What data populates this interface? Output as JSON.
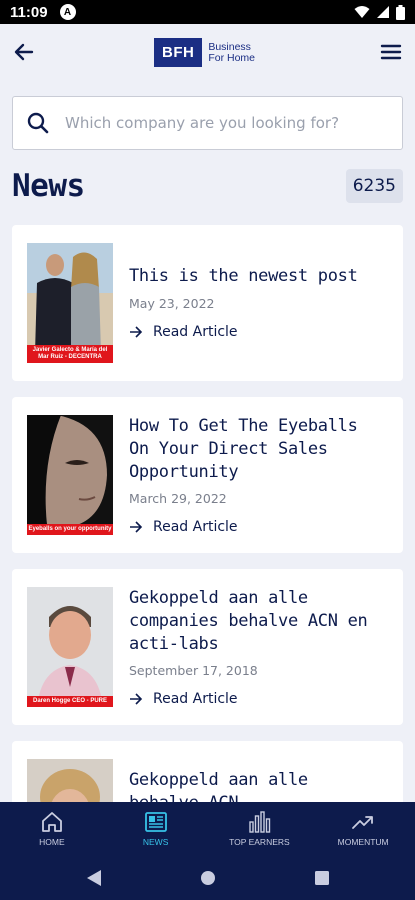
{
  "status_bar": {
    "time": "11:09",
    "badge": "A"
  },
  "header": {
    "logo_mark": "BFH",
    "logo_line1": "Business",
    "logo_line2": "For Home"
  },
  "search": {
    "placeholder": "Which company are you looking for?"
  },
  "news": {
    "title": "News",
    "count": "6235"
  },
  "articles": [
    {
      "title": "This is the newest post",
      "date": "May 23, 2022",
      "link": "Read Article",
      "caption": "Javier Galecto & María del Mar Ruiz - DECENTRA"
    },
    {
      "title": "How To Get The Eyeballs On Your Direct Sales Opportunity",
      "date": "March 29, 2022",
      "link": "Read Article",
      "caption": "Eyeballs on your opportunity"
    },
    {
      "title": "Gekoppeld aan alle companies behalve ACN en acti-labs",
      "date": "September 17, 2018",
      "link": "Read Article",
      "caption": "Daren Hogge CEO - PURE"
    },
    {
      "title": "Gekoppeld aan alle behalve ACN"
    }
  ],
  "bottom_nav": [
    {
      "label": "HOME",
      "icon": "home-icon"
    },
    {
      "label": "NEWS",
      "icon": "news-icon"
    },
    {
      "label": "TOP EARNERS",
      "icon": "bar-chart-icon"
    },
    {
      "label": "MOMENTUM",
      "icon": "trending-up-icon"
    }
  ],
  "colors": {
    "navy": "#0d1b4c",
    "brand_blue": "#1b2e84",
    "active_cyan": "#37c3e8",
    "caption_red": "#e0161c",
    "background": "#eef0f7"
  }
}
